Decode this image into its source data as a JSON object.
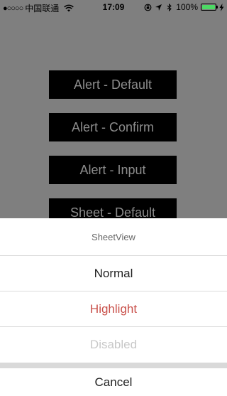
{
  "status_bar": {
    "signal": "●○○○○",
    "carrier": "中国联通",
    "time": "17:09",
    "battery_percent": "100%",
    "battery_fill_fraction": 1.0,
    "icons": [
      "wifi-icon",
      "rotation-lock-icon",
      "location-icon",
      "bluetooth-icon",
      "battery-icon",
      "charging-icon"
    ]
  },
  "demo_buttons": [
    {
      "label": "Alert - Default"
    },
    {
      "label": "Alert - Confirm"
    },
    {
      "label": "Alert - Input"
    },
    {
      "label": "Sheet - Default"
    }
  ],
  "sheet": {
    "title": "SheetView",
    "items": [
      {
        "label": "Normal",
        "style": "normal"
      },
      {
        "label": "Highlight",
        "style": "highlight"
      },
      {
        "label": "Disabled",
        "style": "disabled"
      }
    ],
    "cancel_label": "Cancel"
  },
  "colors": {
    "dimmed_background": "#7f7f7f",
    "button_background": "#000000",
    "highlight_text": "#c9504a",
    "disabled_text": "#c8c8c8",
    "battery_green": "#4cd964"
  }
}
